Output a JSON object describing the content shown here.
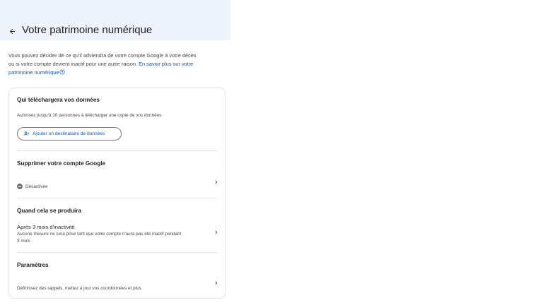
{
  "header": {
    "title": "Votre patrimoine numérique",
    "back_icon": "arrow-back-icon"
  },
  "intro": {
    "text": "Vous pouvez décider de ce qu'il adviendra de votre compte Google à votre décès ou si votre compte devient inactif pour une autre raison. ",
    "link_text": "En savoir plus sur votre patrimoine numérique"
  },
  "sections": {
    "downloaders": {
      "title": "Qui téléchargera vos données",
      "description": "Autorisez jusqu'à 10 personnes à télécharger une copie de vos données",
      "button_label": "Ajouter un destinataire de données"
    },
    "delete": {
      "title": "Supprimer votre compte Google",
      "status": "Désactivée"
    },
    "when": {
      "title": "Quand cela se produira",
      "period": "Après 3 mois d'inactivité",
      "detail_line1": "Aucune mesure ne sera prise tant que votre compte n'aura pas été inactif pendant",
      "detail_line2": "3 mois"
    },
    "settings": {
      "title": "Paramètres",
      "description": "Définissez des rappels, mettez à jour vos coordonnées et plus"
    }
  },
  "colors": {
    "header_bg": "#eef2fa",
    "link": "#0b57d0",
    "text": "#1f1f1f",
    "muted": "#444746",
    "border": "#e3e3e3"
  }
}
